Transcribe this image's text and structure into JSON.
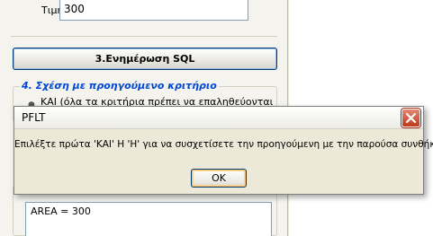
{
  "background": {
    "value_label": "Τιμή:",
    "value_input": "300",
    "sql_button_label": "3.Ενημέρωση SQL",
    "section4_title": "4. Σχέση με προηγούμενο κριτήριο",
    "section4_option_text": "ΚΑΙ (όλα τα κριτήρια πρέπει να επαληθεύονται",
    "sql_text": "AREA  = 300"
  },
  "dialog": {
    "title": "PFLT",
    "message": "Επιλέξτε πρώτα 'ΚΑΙ' Η 'Η' για να συσχετίσετε την προηγούμενη με την παρούσα συνθήκη",
    "ok_label": "OK",
    "close_icon": "close-icon"
  },
  "colors": {
    "section_title": "#0046d5",
    "close_button": "#c1391c",
    "window_bg": "#ece9d8"
  }
}
